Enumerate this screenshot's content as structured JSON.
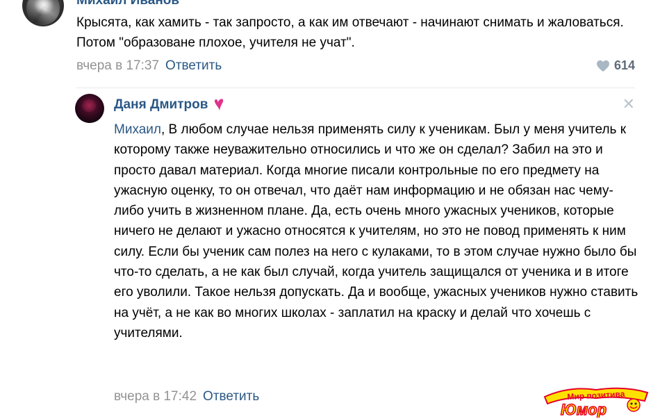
{
  "comment": {
    "author": "Михаил Иванов",
    "text": "Крысята, как хамить - так запросто, а как им отвечают - начинают снимать и жаловаться. Потом \"образоване плохое, учителя не учат\".",
    "time": "вчера в 17:37",
    "reply_label": "Ответить",
    "likes": "614"
  },
  "reply": {
    "author": "Даня Дмитров",
    "mention": "Михаил",
    "text": ", В любом случае нельзя применять силу к ученикам. Был у меня учитель к которому также неуважительно относились и что же он сделал? Забил на это и просто давал материал. Когда многие писали контрольные по его предмету на ужасную оценку, то он отвечал, что даёт нам информацию и не обязан нас чему-либо учить в жизненном плане. Да, есть очень много ужасных учеников, которые ничего не делают и ужасно относятся к учителям, но это не повод применять к ним силу. Если бы ученик сам полез на него с кулаками, то в этом случае нужно было бы что-то сделать, а не как был случай, когда учитель защищался от ученика и в итоге его уволили. Такое нельзя допускать. Да и вообще, ужасных учеников нужно ставить на учёт, а не как во многих школах - заплатил на краску и делай что хочешь с учителями.",
    "time": "вчера в 17:42",
    "reply_label": "Ответить",
    "close_symbol": "✕"
  },
  "watermark": {
    "line1": "Мир позитива",
    "line2": "Юмор"
  },
  "colors": {
    "link": "#2a5885",
    "meta": "#939393",
    "heart": "#e64646",
    "divider": "#e7e8ec"
  }
}
